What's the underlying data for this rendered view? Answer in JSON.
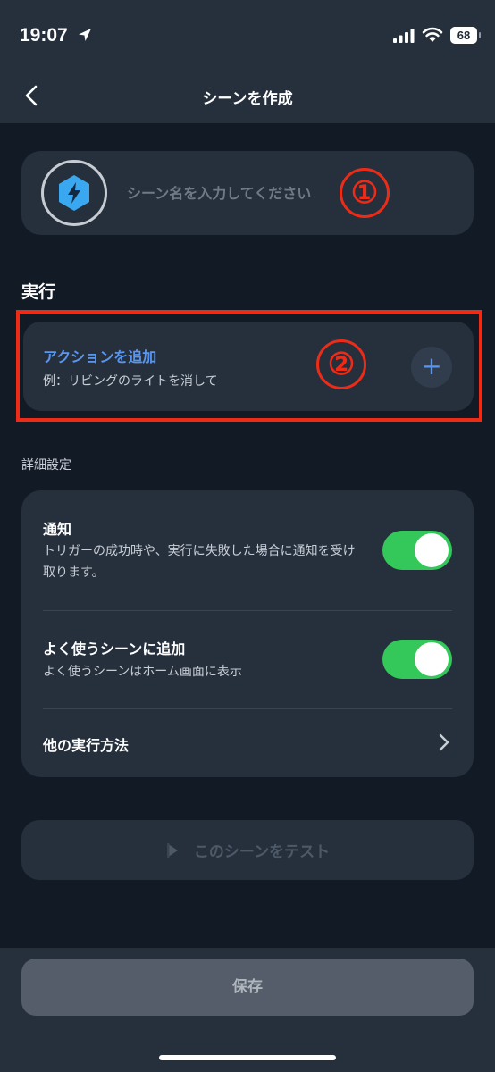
{
  "status_bar": {
    "time": "19:07",
    "battery": "68",
    "icons": [
      "location-arrow-icon",
      "signal-icon",
      "wifi-icon",
      "battery-icon"
    ]
  },
  "nav": {
    "title": "シーンを作成",
    "back_icon": "chevron-left-icon"
  },
  "scene_name": {
    "placeholder": "シーン名を入力してください",
    "value": "",
    "icon": "lightning-icon",
    "marker": "①"
  },
  "execution": {
    "section_title": "実行",
    "action_title": "アクションを追加",
    "action_example": "例：リビングのライトを消して",
    "add_icon_label": "+",
    "marker": "②"
  },
  "advanced": {
    "label": "詳細設定",
    "notification": {
      "title": "通知",
      "description": "トリガーの成功時や、実行に失敗した場合に通知を受け取ります。",
      "enabled": true
    },
    "favorite": {
      "title": "よく使うシーンに追加",
      "description": "よく使うシーンはホーム画面に表示",
      "enabled": true
    },
    "other_methods": {
      "title": "他の実行方法"
    }
  },
  "test_button": {
    "label": "このシーンをテスト",
    "icon": "play-icon"
  },
  "save_button": {
    "label": "保存"
  },
  "colors": {
    "background": "#121a25",
    "card": "#26303d",
    "accent": "#5a96ee",
    "toggle_on": "#34c759",
    "annotation_red": "#ee2b17"
  }
}
